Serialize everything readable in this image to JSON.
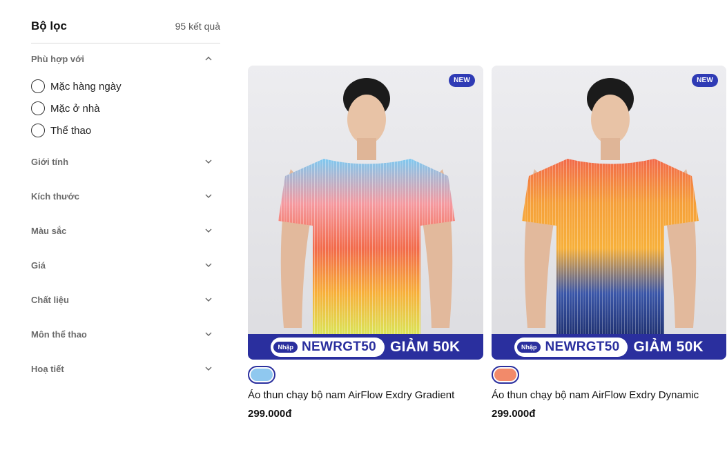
{
  "filter": {
    "title": "Bộ lọc",
    "result_count": "95 kết quả",
    "sections": [
      {
        "label": "Phù hợp với",
        "expanded": true,
        "options": [
          "Mặc hàng ngày",
          "Mặc ở nhà",
          "Thể thao"
        ]
      },
      {
        "label": "Giới tính",
        "expanded": false
      },
      {
        "label": "Kích thước",
        "expanded": false
      },
      {
        "label": "Màu sắc",
        "expanded": false
      },
      {
        "label": "Giá",
        "expanded": false
      },
      {
        "label": "Chất liệu",
        "expanded": false
      },
      {
        "label": "Môn thể thao",
        "expanded": false
      },
      {
        "label": "Hoạ tiết",
        "expanded": false
      }
    ]
  },
  "products": [
    {
      "badge": "NEW",
      "promo": {
        "enter": "Nhập",
        "code": "NEWRGT50",
        "discount": "GIẢM 50K"
      },
      "swatch_color": "#8fc8ef",
      "name": "Áo thun chạy bộ nam AirFlow Exdry Gradient",
      "price": "299.000đ",
      "shirt_colors": [
        "#7ec8f0",
        "#f59aa0",
        "#f26a4a",
        "#f7b03a",
        "#d8e85a"
      ]
    },
    {
      "badge": "NEW",
      "promo": {
        "enter": "Nhập",
        "code": "NEWRGT50",
        "discount": "GIẢM 50K"
      },
      "swatch_color": "#f28a6a",
      "name": "Áo thun chạy bộ nam AirFlow Exdry Dynamic",
      "price": "299.000đ",
      "shirt_colors": [
        "#f26a4a",
        "#f5a03a",
        "#f7b03a",
        "#3a56a8",
        "#1e2f6e"
      ]
    }
  ],
  "colors": {
    "accent": "#2a2f9e",
    "badge": "#2f3bb5"
  }
}
